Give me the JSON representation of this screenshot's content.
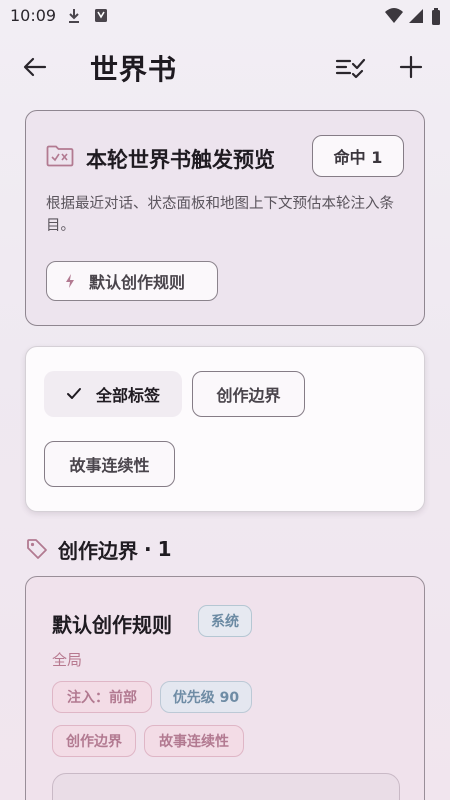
{
  "status_bar": {
    "time": "10:09",
    "icons": [
      "download-icon",
      "notification-icon",
      "wifi-icon",
      "signal-icon",
      "battery-icon"
    ]
  },
  "app_bar": {
    "title": "世界书",
    "icons": [
      "back-arrow-icon",
      "select-all-icon",
      "plus-icon"
    ]
  },
  "preview": {
    "title": "本轮世界书触发预览",
    "hit_label": "命中 1",
    "description": "根据最近对话、状态面板和地图上下文预估本轮注入条目。",
    "rule_chip": "默认创作规则",
    "icon": "folder-x-icon"
  },
  "filters": {
    "all": "全部标签",
    "border": "创作边界",
    "story": "故事连续性"
  },
  "section": {
    "title": "创作边界",
    "separator": "·",
    "count": "1"
  },
  "entry": {
    "title": "默认创作规则",
    "system_badge": "系统",
    "scope": "全局",
    "inject_badge": "注入：前部",
    "priority_badge": "优先级 90",
    "tags": [
      "创作边界",
      "故事连续性"
    ]
  },
  "colors": {
    "accent_pink": "#b27a91",
    "accent_blue": "#6f8ca5",
    "outline": "#857c86"
  }
}
